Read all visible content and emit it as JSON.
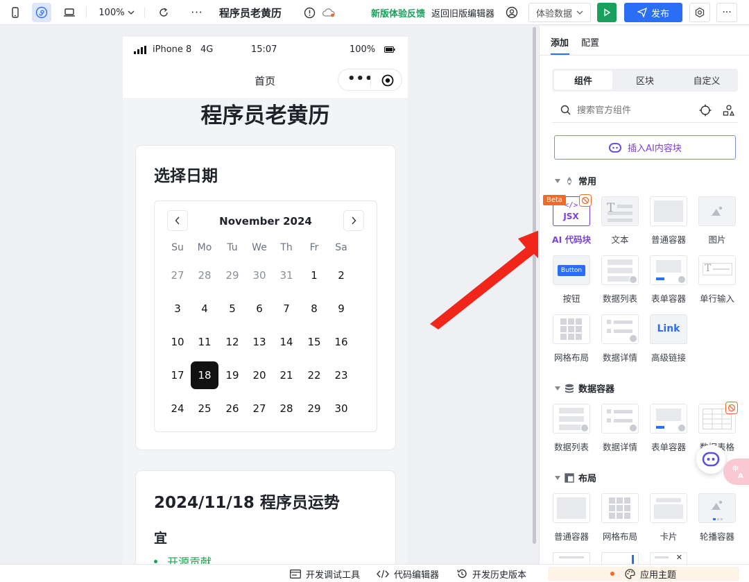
{
  "topbar": {
    "zoom": "100%",
    "app_title": "程序员老黄历",
    "feedback_link": "新版体验反馈",
    "back_old_editor": "返回旧版编辑器",
    "data_select": "体验数据",
    "publish": "发布",
    "colors": {
      "feedback": "#19a05d",
      "run": "#19a05d",
      "publish": "#2a6ef6"
    }
  },
  "phone": {
    "carrier": "iPhone 8",
    "network": "4G",
    "time": "15:07",
    "battery": "100%",
    "nav_title": "首页",
    "page_title": "程序员老黄历",
    "date_card": {
      "title": "选择日期",
      "month": "November 2024",
      "weekdays": [
        "Su",
        "Mo",
        "Tu",
        "We",
        "Th",
        "Fr",
        "Sa"
      ],
      "days": [
        [
          "27",
          "28",
          "29",
          "30",
          "31",
          "1",
          "2"
        ],
        [
          "3",
          "4",
          "5",
          "6",
          "7",
          "8",
          "9"
        ],
        [
          "10",
          "11",
          "12",
          "13",
          "14",
          "15",
          "16"
        ],
        [
          "17",
          "18",
          "19",
          "20",
          "21",
          "22",
          "23"
        ],
        [
          "24",
          "25",
          "26",
          "27",
          "28",
          "29",
          "30"
        ]
      ],
      "selected": "18"
    },
    "fortune_card": {
      "title": "2024/11/18 程序员运势",
      "good_heading": "宜",
      "good_items": [
        "开源贡献"
      ],
      "good_color": "#16a34a"
    }
  },
  "panel": {
    "tabs": [
      "添加",
      "配置"
    ],
    "segments": [
      "组件",
      "区块",
      "自定义"
    ],
    "search_placeholder": "搜索官方组件",
    "ai_button": "插入AI内容块",
    "beta": "Beta",
    "jsx_text": "JSX",
    "button_text": "Button",
    "link_text": "Link",
    "sections": {
      "common": {
        "title": "常用",
        "items": [
          "AI 代码块",
          "文本",
          "普通容器",
          "图片",
          "按钮",
          "数据列表",
          "表单容器",
          "单行输入",
          "网格布局",
          "数据详情",
          "高级链接"
        ]
      },
      "data": {
        "title": "数据容器",
        "items": [
          "数据列表",
          "数据详情",
          "表单容器",
          "数据表格"
        ]
      },
      "layout": {
        "title": "布局",
        "items": [
          "普通容器",
          "网格布局",
          "卡片",
          "轮播容器"
        ]
      }
    },
    "colors": {
      "ai_label": "#7a3fe0",
      "accent": "#2a6ef6",
      "beta": "#f06b2a"
    }
  },
  "bottombar": {
    "debug_tools": "开发调试工具",
    "code_editor": "代码编辑器",
    "history": "开发历史版本",
    "theme": "应用主题"
  }
}
